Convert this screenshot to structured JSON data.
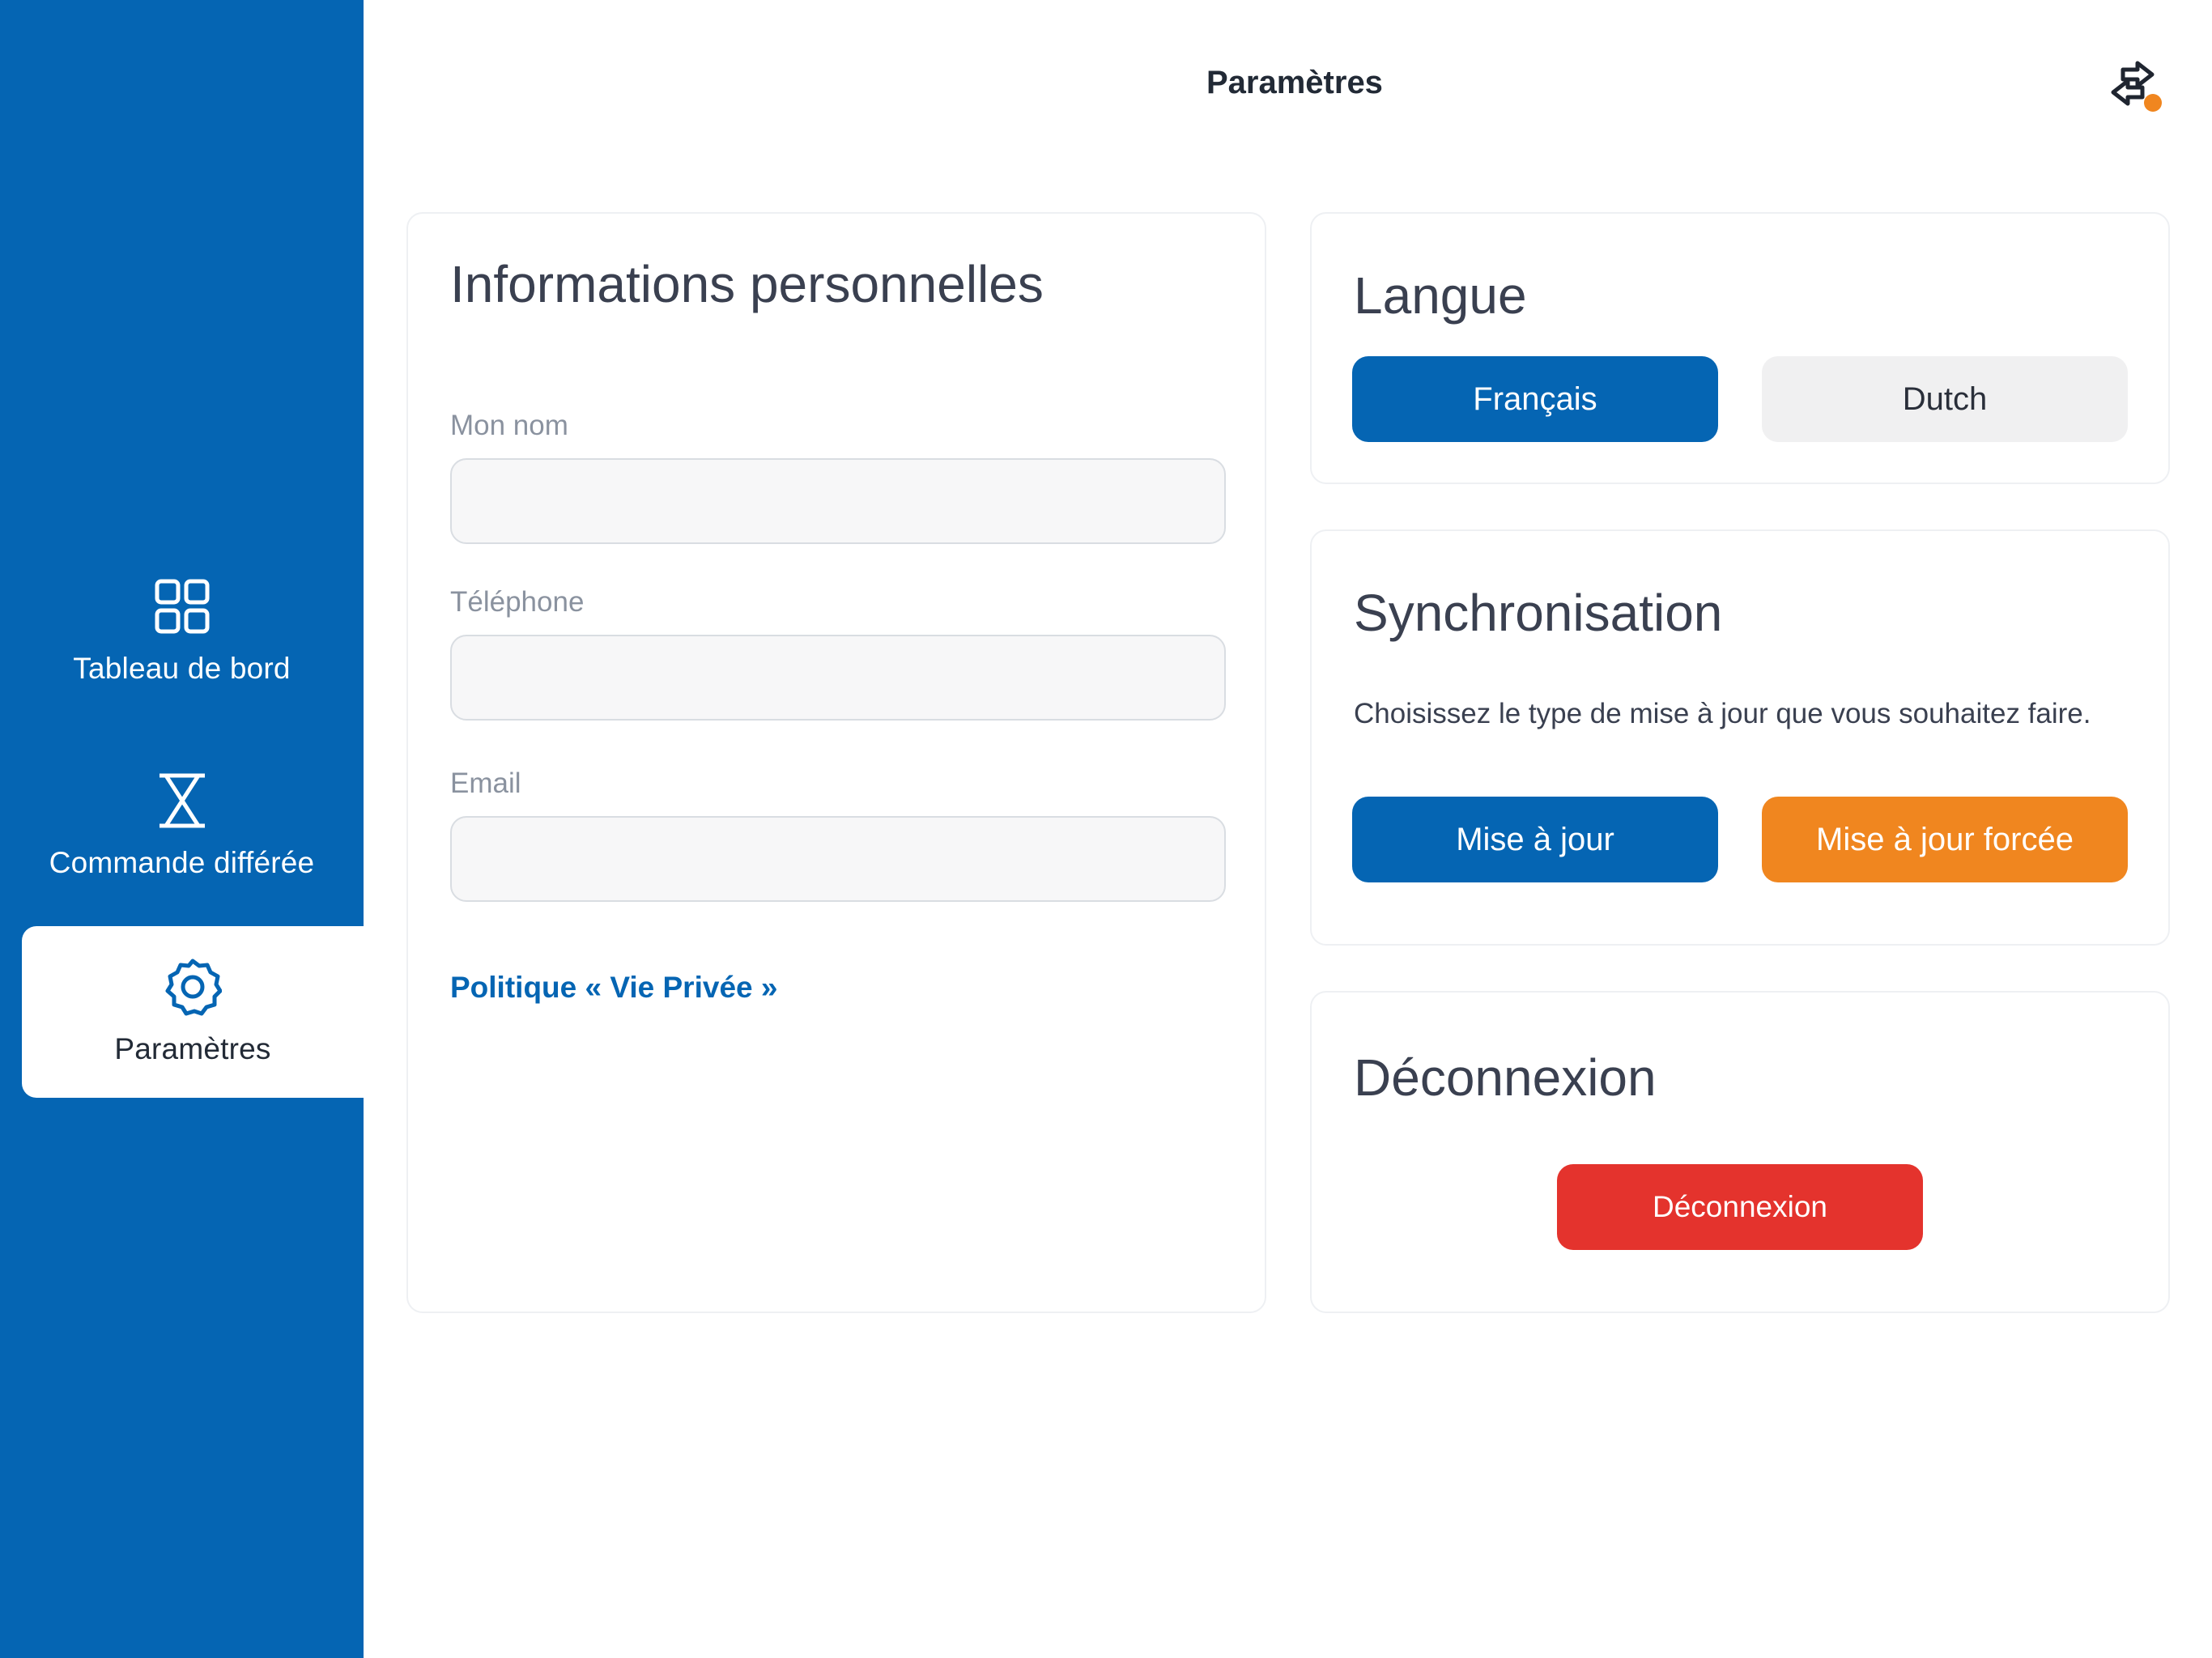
{
  "header": {
    "title": "Paramètres"
  },
  "sidebar": {
    "items": [
      {
        "label": "Tableau de bord",
        "icon": "dashboard-grid-icon"
      },
      {
        "label": "Commande différée",
        "icon": "hourglass-icon"
      },
      {
        "label": "Paramètres",
        "icon": "settings-gear-icon",
        "active": true
      }
    ]
  },
  "personal_info": {
    "title": "Informations personnelles",
    "name_label": "Mon nom",
    "name_value": "",
    "phone_label": "Téléphone",
    "phone_value": "",
    "email_label": "Email",
    "email_value": "",
    "privacy_link": "Politique « Vie Privée »"
  },
  "language": {
    "title": "Langue",
    "options": [
      "Français",
      "Dutch"
    ],
    "selected": "Français"
  },
  "sync": {
    "title": "Synchronisation",
    "description": "Choisissez le type de mise à jour que vous souhaitez faire.",
    "update_label": "Mise à jour",
    "force_update_label": "Mise à jour forcée"
  },
  "logout": {
    "title": "Déconnexion",
    "button_label": "Déconnexion"
  },
  "colors": {
    "primary": "#0565b3",
    "orange": "#f0861f",
    "red": "#e4332d"
  }
}
